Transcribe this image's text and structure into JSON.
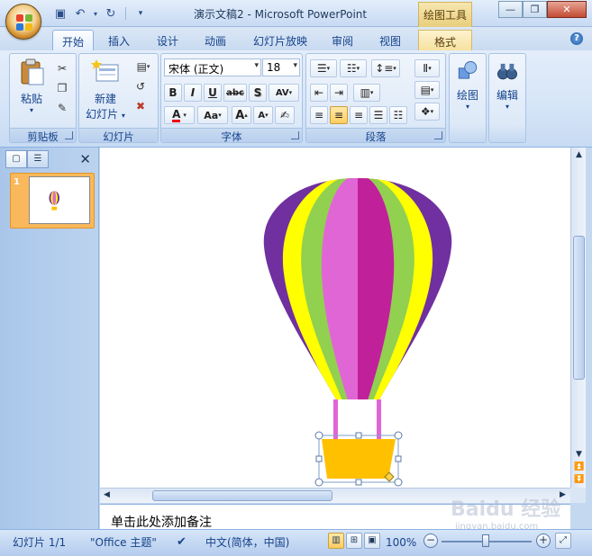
{
  "window": {
    "title": "演示文稿2 - Microsoft PowerPoint",
    "context_tab_group": "绘图工具"
  },
  "tabs": [
    {
      "label": "开始",
      "active": true
    },
    {
      "label": "插入"
    },
    {
      "label": "设计"
    },
    {
      "label": "动画"
    },
    {
      "label": "幻灯片放映"
    },
    {
      "label": "审阅"
    },
    {
      "label": "视图"
    },
    {
      "label": "格式",
      "context": true
    }
  ],
  "ribbon": {
    "clipboard": {
      "label": "剪贴板",
      "paste_label": "粘贴"
    },
    "slides": {
      "label": "幻灯片",
      "new_slide_line1": "新建",
      "new_slide_line2": "幻灯片"
    },
    "font": {
      "label": "字体",
      "font_name": "宋体 (正文)",
      "font_size": "18",
      "bold": "B",
      "italic": "I",
      "underline": "U",
      "strike": "abc",
      "shadow": "S",
      "spacing": "AV",
      "font_color": "A",
      "change_case": "Aa",
      "grow": "A",
      "shrink": "A"
    },
    "paragraph": {
      "label": "段落"
    },
    "drawing": {
      "label": "绘图"
    },
    "editing": {
      "label": "编辑"
    }
  },
  "slide_pane": {
    "slide_number": "1"
  },
  "notes": {
    "placeholder": "单击此处添加备注"
  },
  "status": {
    "slide_info": "幻灯片 1/1",
    "theme": "\"Office 主题\"",
    "language": "中文(简体，中国)",
    "zoom": "100%"
  },
  "watermark": {
    "text": "Baidu 经验",
    "sub": "jingyan.baidu.com"
  },
  "colors": {
    "balloon_purple_dark": "#7030a0",
    "balloon_yellow": "#ffff00",
    "balloon_green": "#92d050",
    "balloon_pink": "#e066d6",
    "balloon_magenta": "#c0209a",
    "rope": "#e066d6",
    "basket": "#ffc000"
  }
}
